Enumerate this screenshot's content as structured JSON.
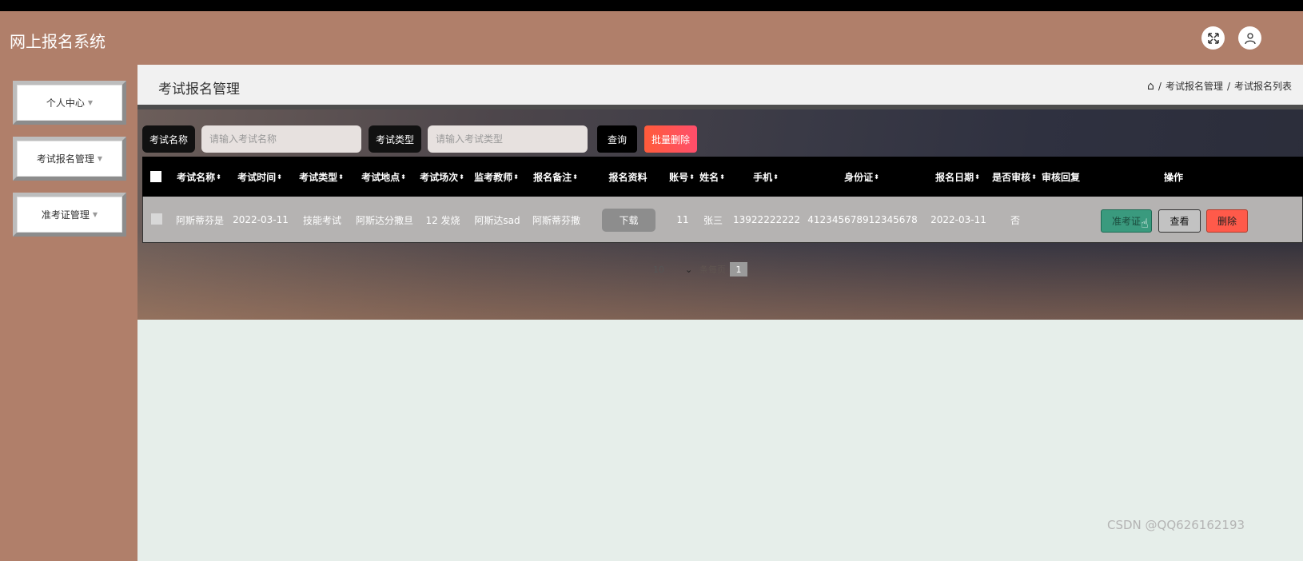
{
  "app": {
    "title": "网上报名系统"
  },
  "header_icons": [
    "expand-icon",
    "user-icon"
  ],
  "sidebar": {
    "items": [
      {
        "label": "个人中心"
      },
      {
        "label": "考试报名管理"
      },
      {
        "label": "准考证管理"
      }
    ]
  },
  "page": {
    "title": "考试报名管理",
    "breadcrumb": [
      "考试报名管理",
      "考试报名列表"
    ]
  },
  "search": {
    "name_label": "考试名称",
    "name_placeholder": "请输入考试名称",
    "type_label": "考试类型",
    "type_placeholder": "请输入考试类型",
    "query_label": "查询",
    "batch_delete_label": "批量删除"
  },
  "table": {
    "columns": [
      "考试名称",
      "考试时间",
      "考试类型",
      "考试地点",
      "考试场次",
      "监考教师",
      "报名备注",
      "报名资料",
      "账号",
      "姓名",
      "手机",
      "身份证",
      "报名日期",
      "是否审核",
      "审核回复",
      "操作"
    ],
    "rows": [
      {
        "exam_name": "阿斯蒂芬是",
        "exam_time": "2022-03-11",
        "exam_type": "技能考试",
        "exam_place": "阿斯达分撒旦",
        "exam_session": "12 发烧",
        "invigilator": "阿斯达sad",
        "note": "阿斯蒂芬撒",
        "material_button": "下载",
        "account": "11",
        "name": "张三",
        "phone": "13922222222",
        "id_card": "412345678912345678",
        "signup_date": "2022-03-11",
        "reviewed": "否",
        "review_reply": "",
        "actions": {
          "ticket": "准考证",
          "view": "查看",
          "delete": "删除"
        }
      }
    ]
  },
  "pagination": {
    "page_size": "10",
    "text": "条每页",
    "current_page": "1"
  },
  "watermark": "CSDN @QQ626162193",
  "colors": {
    "header_bg": "#b07f6a",
    "table_header": "#000000",
    "accent_green": "#3a9a7e",
    "accent_red": "#ff5a4a"
  }
}
